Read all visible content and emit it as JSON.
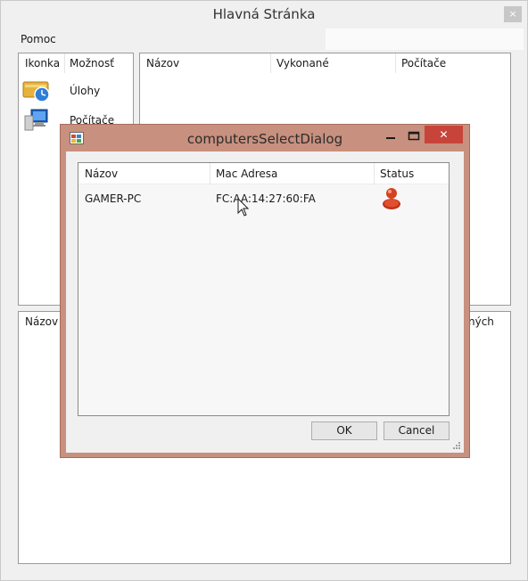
{
  "main_window": {
    "title": "Hlavná Stránka",
    "close_glyph": "×",
    "menu": {
      "help_label": "Pomoc"
    }
  },
  "left_panel": {
    "columns": [
      "Ikonka",
      "Možnosť"
    ],
    "items": [
      {
        "label": "Úlohy",
        "icon": "tasks-clock-icon"
      },
      {
        "label": "Počítače",
        "icon": "computers-icon"
      }
    ]
  },
  "tasks_panel": {
    "columns": [
      "Názov",
      "Vykonané",
      "Počítače"
    ]
  },
  "bottom_panel": {
    "columns": [
      "Názov",
      "ných"
    ]
  },
  "dialog": {
    "title": "computersSelectDialog",
    "close_glyph": "✕",
    "columns": [
      "Názov",
      "Mac Adresa",
      "Status"
    ],
    "rows": [
      {
        "name": "GAMER-PC",
        "mac": "FC:AA:14:27:60:FA",
        "status_icon": "user-online-icon"
      }
    ],
    "ok_label": "OK",
    "cancel_label": "Cancel"
  },
  "colors": {
    "dialog_frame": "#c8907e",
    "close_button": "#c7443a",
    "window_bg": "#f0f0f0"
  }
}
